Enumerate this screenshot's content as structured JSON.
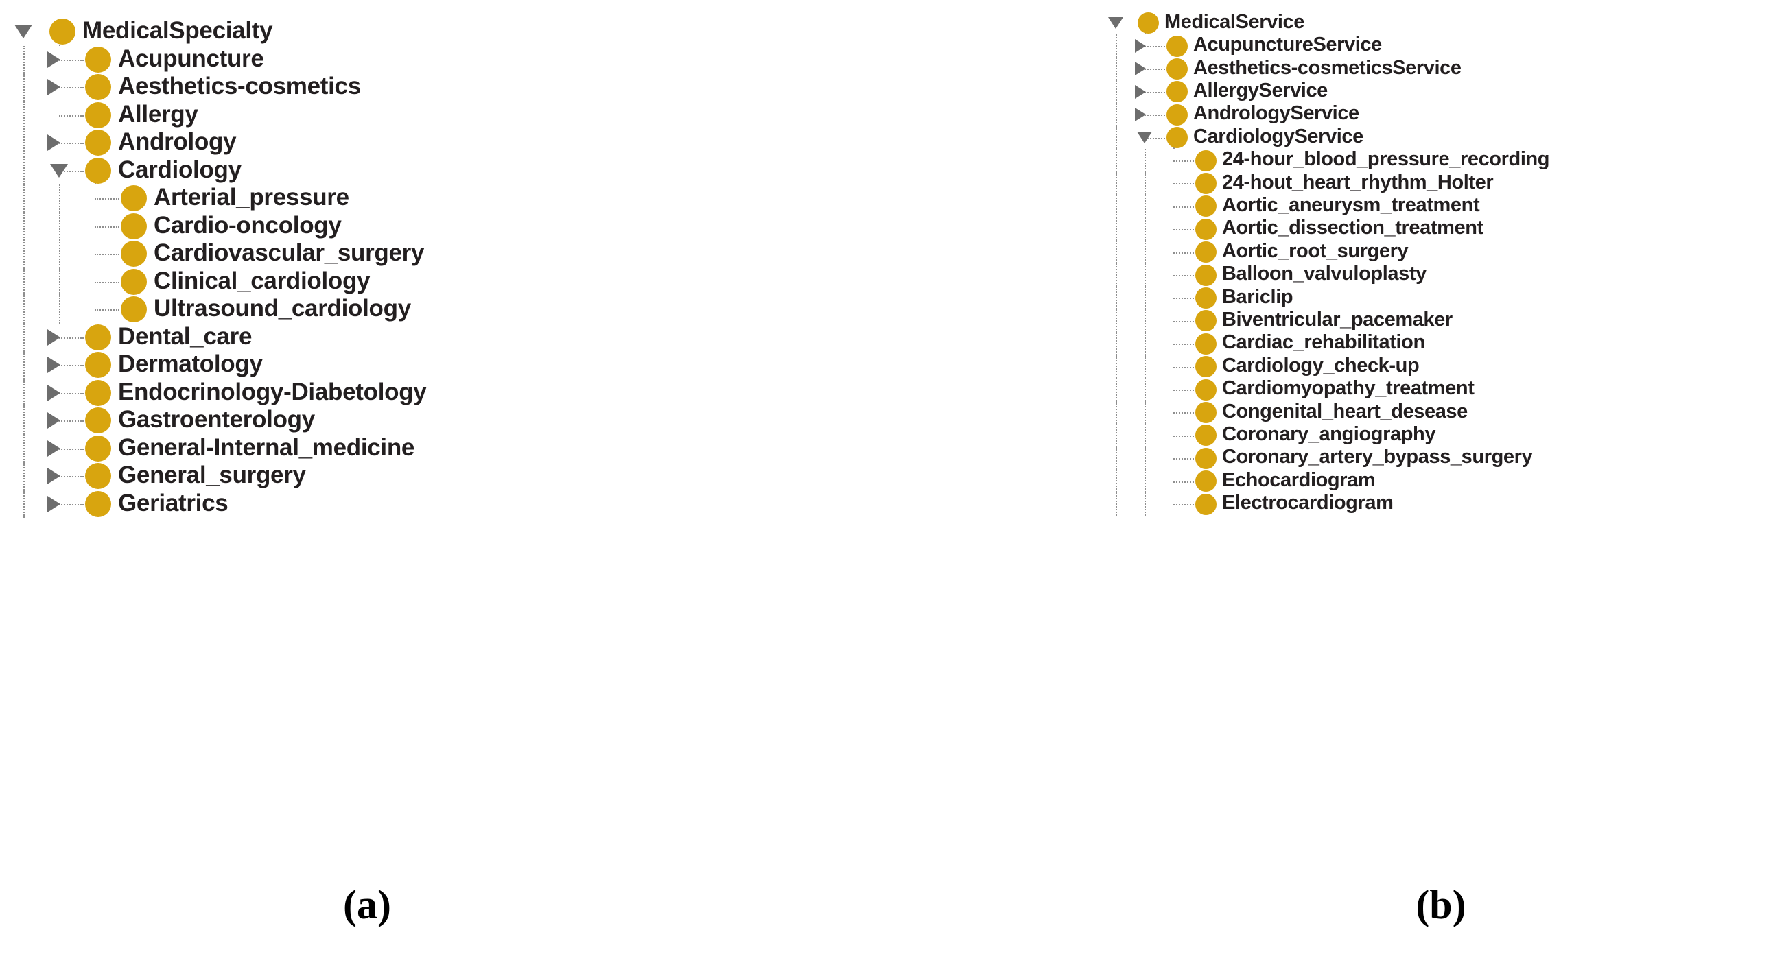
{
  "figure": {
    "background_color": "#ffffff",
    "node_color": "#d8a50f",
    "toggle_color": "#6d6d6d",
    "guide_color": "#8f8f8f",
    "text_color": "#231f20"
  },
  "panel_a": {
    "caption": "(a)",
    "root": {
      "label": "MedicalSpecialty",
      "state": "expanded",
      "icon": "class-circle-icon",
      "toggle_icon": "triangle-down-icon"
    },
    "items": [
      {
        "label": "MedicalSpecialty",
        "depth": 0,
        "state": "expanded",
        "toggle_icon": "triangle-down-icon"
      },
      {
        "label": "Acupuncture",
        "depth": 1,
        "state": "collapsed",
        "toggle_icon": "triangle-right-icon"
      },
      {
        "label": "Aesthetics-cosmetics",
        "depth": 1,
        "state": "collapsed",
        "toggle_icon": "triangle-right-icon"
      },
      {
        "label": "Allergy",
        "depth": 1,
        "state": "leaf",
        "toggle_icon": "none"
      },
      {
        "label": "Andrology",
        "depth": 1,
        "state": "collapsed",
        "toggle_icon": "triangle-right-icon"
      },
      {
        "label": "Cardiology",
        "depth": 1,
        "state": "expanded",
        "toggle_icon": "triangle-down-icon"
      },
      {
        "label": "Arterial_pressure",
        "depth": 2,
        "state": "leaf",
        "toggle_icon": "none"
      },
      {
        "label": "Cardio-oncology",
        "depth": 2,
        "state": "leaf",
        "toggle_icon": "none"
      },
      {
        "label": "Cardiovascular_surgery",
        "depth": 2,
        "state": "leaf",
        "toggle_icon": "none"
      },
      {
        "label": "Clinical_cardiology",
        "depth": 2,
        "state": "leaf",
        "toggle_icon": "none"
      },
      {
        "label": "Ultrasound_cardiology",
        "depth": 2,
        "state": "leaf",
        "toggle_icon": "none"
      },
      {
        "label": "Dental_care",
        "depth": 1,
        "state": "collapsed",
        "toggle_icon": "triangle-right-icon"
      },
      {
        "label": "Dermatology",
        "depth": 1,
        "state": "collapsed",
        "toggle_icon": "triangle-right-icon"
      },
      {
        "label": "Endocrinology-Diabetology",
        "depth": 1,
        "state": "collapsed",
        "toggle_icon": "triangle-right-icon"
      },
      {
        "label": "Gastroenterology",
        "depth": 1,
        "state": "collapsed",
        "toggle_icon": "triangle-right-icon"
      },
      {
        "label": "General-Internal_medicine",
        "depth": 1,
        "state": "collapsed",
        "toggle_icon": "triangle-right-icon"
      },
      {
        "label": "General_surgery",
        "depth": 1,
        "state": "collapsed",
        "toggle_icon": "triangle-right-icon"
      },
      {
        "label": "Geriatrics",
        "depth": 1,
        "state": "collapsed",
        "toggle_icon": "triangle-right-icon"
      }
    ]
  },
  "panel_b": {
    "caption": "(b)",
    "root": {
      "label": "MedicalService",
      "state": "expanded",
      "icon": "class-circle-icon",
      "toggle_icon": "triangle-down-icon"
    },
    "items": [
      {
        "label": "MedicalService",
        "depth": 0,
        "state": "expanded",
        "toggle_icon": "triangle-down-icon"
      },
      {
        "label": "AcupunctureService",
        "depth": 1,
        "state": "collapsed",
        "toggle_icon": "triangle-right-icon"
      },
      {
        "label": "Aesthetics-cosmeticsService",
        "depth": 1,
        "state": "collapsed",
        "toggle_icon": "triangle-right-icon"
      },
      {
        "label": "AllergyService",
        "depth": 1,
        "state": "collapsed",
        "toggle_icon": "triangle-right-icon"
      },
      {
        "label": "AndrologyService",
        "depth": 1,
        "state": "collapsed",
        "toggle_icon": "triangle-right-icon"
      },
      {
        "label": "CardiologyService",
        "depth": 1,
        "state": "expanded",
        "toggle_icon": "triangle-down-icon"
      },
      {
        "label": "24-hour_blood_pressure_recording",
        "depth": 2,
        "state": "leaf",
        "toggle_icon": "none"
      },
      {
        "label": "24-hout_heart_rhythm_Holter",
        "depth": 2,
        "state": "leaf",
        "toggle_icon": "none"
      },
      {
        "label": "Aortic_aneurysm_treatment",
        "depth": 2,
        "state": "leaf",
        "toggle_icon": "none"
      },
      {
        "label": "Aortic_dissection_treatment",
        "depth": 2,
        "state": "leaf",
        "toggle_icon": "none"
      },
      {
        "label": "Aortic_root_surgery",
        "depth": 2,
        "state": "leaf",
        "toggle_icon": "none"
      },
      {
        "label": "Balloon_valvuloplasty",
        "depth": 2,
        "state": "leaf",
        "toggle_icon": "none"
      },
      {
        "label": "Bariclip",
        "depth": 2,
        "state": "leaf",
        "toggle_icon": "none"
      },
      {
        "label": "Biventricular_pacemaker",
        "depth": 2,
        "state": "leaf",
        "toggle_icon": "none"
      },
      {
        "label": "Cardiac_rehabilitation",
        "depth": 2,
        "state": "leaf",
        "toggle_icon": "none"
      },
      {
        "label": "Cardiology_check-up",
        "depth": 2,
        "state": "leaf",
        "toggle_icon": "none"
      },
      {
        "label": "Cardiomyopathy_treatment",
        "depth": 2,
        "state": "leaf",
        "toggle_icon": "none"
      },
      {
        "label": "Congenital_heart_desease",
        "depth": 2,
        "state": "leaf",
        "toggle_icon": "none"
      },
      {
        "label": "Coronary_angiography",
        "depth": 2,
        "state": "leaf",
        "toggle_icon": "none"
      },
      {
        "label": "Coronary_artery_bypass_surgery",
        "depth": 2,
        "state": "leaf",
        "toggle_icon": "none"
      },
      {
        "label": "Echocardiogram",
        "depth": 2,
        "state": "leaf",
        "toggle_icon": "none"
      },
      {
        "label": "Electrocardiogram",
        "depth": 2,
        "state": "leaf",
        "toggle_icon": "none"
      }
    ]
  }
}
